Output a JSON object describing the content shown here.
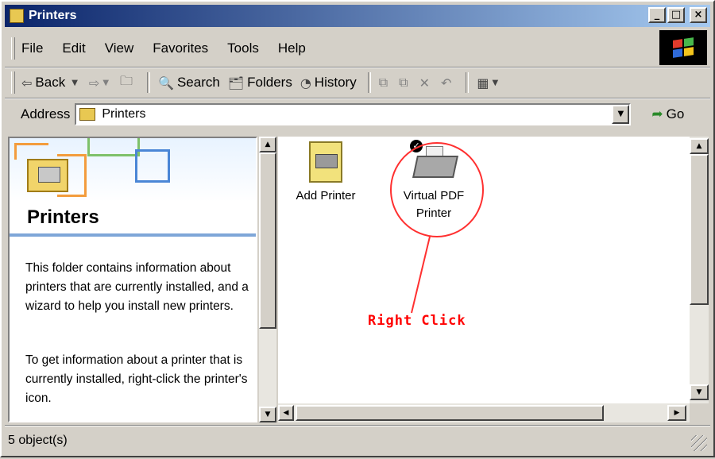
{
  "window": {
    "title": "Printers"
  },
  "title_buttons": {
    "minimize": "_",
    "maximize": "□",
    "close": "×"
  },
  "menu": [
    "File",
    "Edit",
    "View",
    "Favorites",
    "Tools",
    "Help"
  ],
  "toolbar": {
    "back": "Back",
    "search": "Search",
    "folders": "Folders",
    "history": "History"
  },
  "address": {
    "label": "Address",
    "value": "Printers",
    "go": "Go"
  },
  "left_pane": {
    "title": "Printers",
    "paragraph1": "This folder contains information about printers that are currently installed, and a wizard to help you install new printers.",
    "paragraph2": "To get information about a printer that is currently installed, right-click the printer's icon."
  },
  "items": [
    {
      "label": "Add Printer",
      "icon": "add-printer-icon"
    },
    {
      "label": "Virtual PDF Printer",
      "icon": "printer-icon"
    }
  ],
  "annotation": {
    "text": "Right Click",
    "color": "#ff0000"
  },
  "status": {
    "text": "5 object(s)"
  }
}
